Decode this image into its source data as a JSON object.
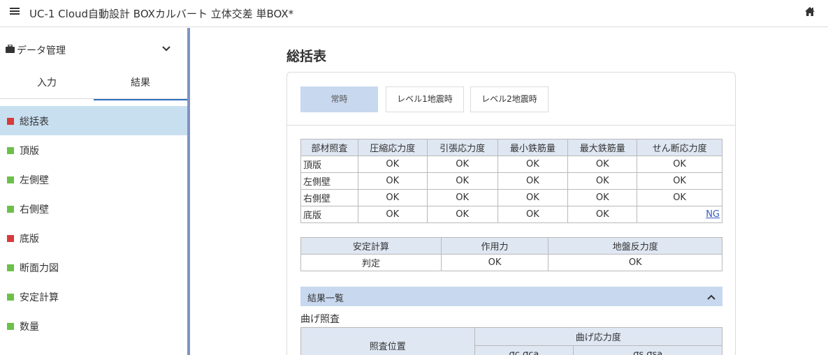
{
  "header": {
    "title": "UC-1 Cloud自動設計 BOXカルバート 立体交差 単BOX*"
  },
  "sidebar": {
    "section_label": "データ管理",
    "tabs": [
      {
        "label": "入力"
      },
      {
        "label": "結果"
      }
    ],
    "items": [
      {
        "label": "総括表",
        "status_color": "#d93a3a"
      },
      {
        "label": "頂版",
        "status_color": "#6cc04a"
      },
      {
        "label": "左側壁",
        "status_color": "#6cc04a"
      },
      {
        "label": "右側壁",
        "status_color": "#6cc04a"
      },
      {
        "label": "底版",
        "status_color": "#d93a3a"
      },
      {
        "label": "断面力図",
        "status_color": "#6cc04a"
      },
      {
        "label": "安定計算",
        "status_color": "#6cc04a"
      },
      {
        "label": "数量",
        "status_color": "#6cc04a"
      }
    ]
  },
  "main": {
    "title": "総括表",
    "case_tabs": [
      {
        "label": "常時"
      },
      {
        "label": "レベル1地震時"
      },
      {
        "label": "レベル2地震時"
      }
    ],
    "member_table": {
      "headers": [
        "部材照査",
        "圧縮応力度",
        "引張応力度",
        "最小鉄筋量",
        "最大鉄筋量",
        "せん断応力度"
      ],
      "rows": [
        {
          "name": "頂版",
          "cells": [
            "OK",
            "OK",
            "OK",
            "OK",
            "OK"
          ]
        },
        {
          "name": "左側壁",
          "cells": [
            "OK",
            "OK",
            "OK",
            "OK",
            "OK"
          ]
        },
        {
          "name": "右側壁",
          "cells": [
            "OK",
            "OK",
            "OK",
            "OK",
            "OK"
          ]
        },
        {
          "name": "底版",
          "cells": [
            "OK",
            "OK",
            "OK",
            "OK",
            "NG"
          ]
        }
      ]
    },
    "stability_table": {
      "headers": [
        "安定計算",
        "作用力",
        "地盤反力度"
      ],
      "row": {
        "name": "判定",
        "cells": [
          "OK",
          "OK"
        ]
      }
    },
    "result_list": {
      "label": "結果一覧"
    },
    "bending": {
      "title": "曲げ照査",
      "col_position": "照査位置",
      "col_stress": "曲げ応力度",
      "sub_a": "σc  σca",
      "sub_b": "σs  σsa"
    }
  }
}
